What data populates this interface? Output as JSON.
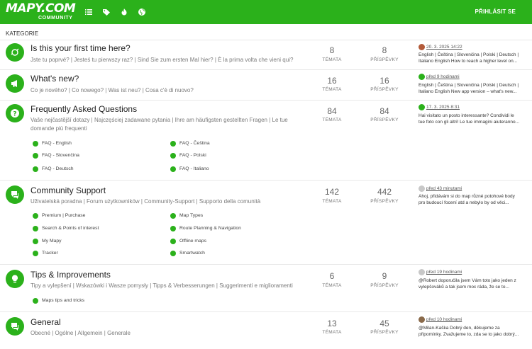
{
  "header": {
    "logo_main": "MAPY.COM",
    "logo_sub": "COMMUNITY",
    "login_label": "PŘIHLÁSIT SE"
  },
  "section_label": "KATEGORIE",
  "stat_labels": {
    "topics": "TÉMATA",
    "posts": "PŘÍSPĚVKY"
  },
  "categories": [
    {
      "title": "Is this your first time here?",
      "desc": "Jste tu poprvé? | Jesteś tu pierwszy raz? | Sind Sie zum ersten Mal hier? | È la prima volta che vieni qui?",
      "topics": "8",
      "posts": "8",
      "last_time": "20. 3. 2025 14:22",
      "last_text": "English | Čeština | Slovenčina | Polski | Deutsch | Italiano English How to reach a higher level on..."
    },
    {
      "title": "What's new?",
      "desc": "Co je nového? | Co nowego? | Was ist neu? | Cosa c'è di nuovo?",
      "topics": "16",
      "posts": "16",
      "last_time": "před 9 hodinami",
      "last_text": "English | Čeština | Slovenčina | Polski | Deutsch | Italiano English New app version – what's new..."
    },
    {
      "title": "Frequently Asked Questions",
      "desc": "Vaše nejčastější dotazy | Najczęściej zadawane pytania | Ihre am häufigsten gestellten Fragen | Le tue domande più frequenti",
      "topics": "84",
      "posts": "84",
      "last_time": "17. 3. 2025 8:31",
      "last_text": "Hai visitato un posto interessante? Condividi le tue foto con gli altri! Le tue immagini aiuteranno...",
      "subs": [
        "FAQ - English",
        "FAQ - Čeština",
        "FAQ - Slovenčina",
        "FAQ - Polski",
        "FAQ - Deutsch",
        "FAQ - Italiano"
      ]
    },
    {
      "title": "Community Support",
      "desc": "Uživatelská poradna | Forum użytkowników | Community-Support | Supporto della comunità",
      "topics": "142",
      "posts": "442",
      "last_time": "před 43 minutami",
      "last_text": "Ahoj, přidávám si do map různé potohové body pro budoucí focení atd a nebylo by od věci...",
      "subs": [
        "Premium | Purchase",
        "Map Types",
        "Search & Points of interest",
        "Route Planning & Navigation",
        "My Mapy",
        "Offline maps",
        "Tracker",
        "Smartwatch"
      ]
    },
    {
      "title": "Tips & Improvements",
      "desc": "Tipy a vylepšení | Wskazówki i Wasze pomysły | Tipps & Verbesserungen | Suggerimenti e miglioramenti",
      "topics": "6",
      "posts": "9",
      "last_time": "před 19 hodinami",
      "last_text": "@Robert doporučila jsem Vám toto jako jeden z vylepšováků a tak jsem moc ráda, že se to...",
      "subs": [
        "Maps tips and tricks"
      ]
    },
    {
      "title": "General",
      "desc": "Obecné | Ogólne | Allgemein | Generale",
      "topics": "13",
      "posts": "45",
      "last_time": "před 10 hodinami",
      "last_text": "@Milan-Kaška Dobrý den, děkujeme za připomínky. Zvažujeme to, zda se to jako dobrý..."
    }
  ],
  "colors": {
    "brand": "#2bb11b"
  }
}
